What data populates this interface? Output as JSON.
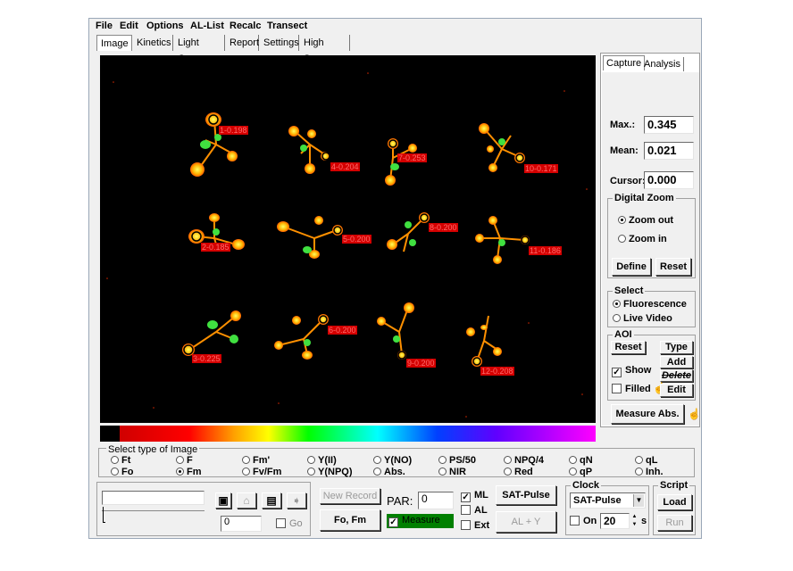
{
  "menu": [
    "File",
    "Edit",
    "Options",
    "AL-List",
    "Recalc",
    "Transect"
  ],
  "tabs": [
    "Image",
    "Kinetics",
    "Light Curve",
    "Report",
    "Settings",
    "High Sens."
  ],
  "right_tabs": [
    "Capture",
    "Analysis"
  ],
  "stats": {
    "max_label": "Max.:",
    "max_value": "0.345",
    "mean_label": "Mean:",
    "mean_value": "0.021",
    "cursor_label": "Cursor:",
    "cursor_value": "0.000"
  },
  "digital_zoom": {
    "title": "Digital Zoom",
    "zoom_out": "Zoom out",
    "zoom_in": "Zoom in",
    "define": "Define",
    "reset": "Reset"
  },
  "select": {
    "title": "Select",
    "fluorescence": "Fluorescence",
    "live_video": "Live Video"
  },
  "aoi": {
    "title": "AOI",
    "reset": "Reset",
    "type": "Type",
    "add": "Add",
    "delete": "Delete",
    "edit": "Edit",
    "show": "Show",
    "filled": "Filled"
  },
  "measure_abs": "Measure Abs.",
  "aoi_labels": [
    "1-0.198",
    "4-0.204",
    "7-0.253",
    "10-0.171",
    "2-0.185",
    "5-0.200",
    "8-0.200",
    "11-0.186",
    "3-0.225",
    "6-0.200",
    "9-0.200",
    "12-0.208"
  ],
  "image_type": {
    "title": "Select type of Image",
    "row1": [
      "Ft",
      "F",
      "Fm'",
      "Y(II)",
      "Y(NO)",
      "PS/50",
      "NPQ/4",
      "qN",
      "qL"
    ],
    "row2": [
      "Fo",
      "Fm",
      "Fv/Fm",
      "Y(NPQ)",
      "Abs.",
      "NIR",
      "Red",
      "qP",
      "Inh."
    ],
    "selected": "Fm"
  },
  "bottom": {
    "record_value": "0",
    "go": "Go",
    "new_record": "New Record",
    "fo_fm": "Fo, Fm",
    "par_label": "PAR:",
    "par_value": "0",
    "measure": "Measure",
    "ml": "ML",
    "al": "AL",
    "ext": "Ext",
    "sat_pulse": "SAT-Pulse",
    "al_y": "AL + Y",
    "clock_title": "Clock",
    "clock_select": "SAT-Pulse",
    "on": "On",
    "interval": "20",
    "unit": "s",
    "script_title": "Script",
    "load": "Load",
    "run": "Run"
  },
  "colors": {
    "aoi_label_bg": "#d40000",
    "measure_bg": "#008000",
    "image_bg": "#000000"
  }
}
